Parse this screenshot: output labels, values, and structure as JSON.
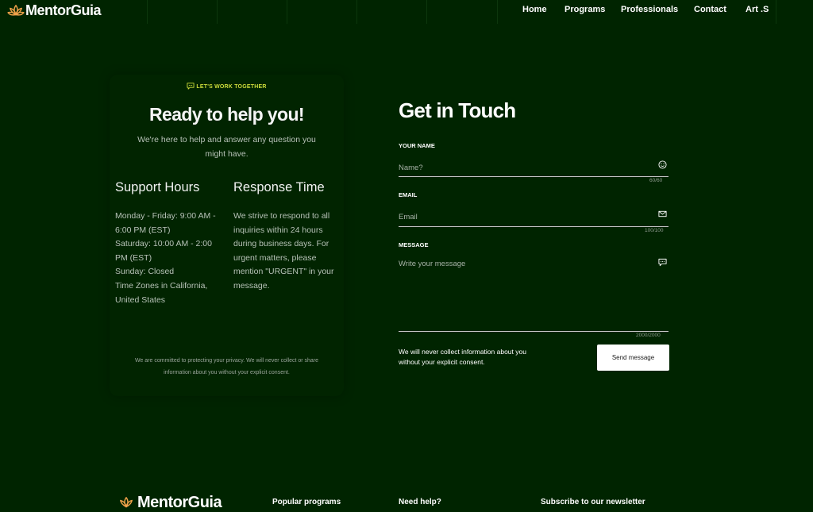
{
  "brand": {
    "name": "MentorGuia"
  },
  "nav": {
    "items": [
      "Home",
      "Programs",
      "Professionals",
      "Contact",
      "Art .S"
    ]
  },
  "card": {
    "tag": "LET'S WORK TOGETHER",
    "title": "Ready to help you!",
    "subtitle": "We're here to help and answer any question you might have.",
    "support": {
      "title": "Support Hours",
      "lines": [
        "Monday - Friday: 9:00 AM -",
        "6:00 PM (EST)",
        "Saturday: 10:00 AM - 2:00",
        "PM (EST)",
        "Sunday: Closed",
        "Time Zones in California,",
        "United States"
      ]
    },
    "response": {
      "title": "Response Time",
      "lines": [
        "We strive to respond to all",
        "inquiries within 24 hours",
        "during business days. For",
        "urgent matters, please",
        "mention \"URGENT\" in your",
        "message."
      ]
    },
    "privacy_lines": [
      "We are committed to protecting your privacy. We will never collect or share",
      "information about you without your explicit consent."
    ]
  },
  "form": {
    "title": "Get in Touch",
    "name": {
      "label": "YOUR NAME",
      "placeholder": "Name?",
      "value": "",
      "counter": "60/60"
    },
    "email": {
      "label": "EMAIL",
      "placeholder": "Email",
      "value": "",
      "counter": "100/100"
    },
    "message": {
      "label": "MESSAGE",
      "placeholder": "Write your message",
      "value": "",
      "counter": "2000/2000"
    },
    "consent_lines": [
      "We will never collect information about you",
      "without your explicit consent."
    ],
    "send_label": "Send message"
  },
  "footer": {
    "brand": "MentorGuia",
    "headings": [
      "Popular programs",
      "Need help?",
      "Subscribe to our newsletter"
    ]
  },
  "icons": {
    "logo": "lotus-icon",
    "tag": "chat-icon",
    "name_field": "smiley-icon",
    "email_field": "envelope-icon",
    "message_field": "chat-bubble-icon"
  },
  "colors": {
    "background": "#002400",
    "accent": "#cddc3a",
    "logo": "#f0a24a",
    "button": "#ffffff"
  }
}
